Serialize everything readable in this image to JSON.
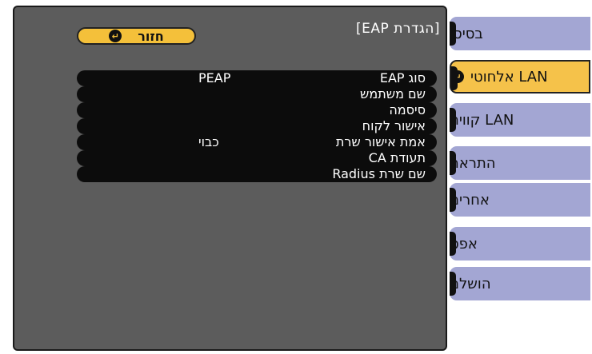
{
  "tabs": [
    {
      "label": "בסיסי"
    },
    {
      "label": "LAN אלחוטי"
    },
    {
      "label": "LAN קווית"
    },
    {
      "label": "התראה"
    },
    {
      "label": "אחרים"
    },
    {
      "label": "אפס"
    },
    {
      "label": "הושלם"
    }
  ],
  "panel": {
    "title": "[הגדרת EAP]",
    "back_label": "חזור"
  },
  "settings": [
    {
      "label": "סוג EAP",
      "value": "PEAP"
    },
    {
      "label": "שם משתמש",
      "value": ""
    },
    {
      "label": "סיסמה",
      "value": ""
    },
    {
      "label": "אישור לקוח",
      "value": ""
    },
    {
      "label": "אמת אישור שרת",
      "value": "כבוי"
    },
    {
      "label": "תעודת CA",
      "value": ""
    },
    {
      "label": "שם שרת Radius",
      "value": ""
    }
  ],
  "colors": {
    "panel_bg": "#5c5c5c",
    "tab_bg": "#a3a6d3",
    "active_tab_bg": "#f5c24a",
    "row_bg": "#0c0c0c",
    "button_bg": "#f4c03a"
  },
  "icons": {
    "enter": "enter-icon"
  }
}
